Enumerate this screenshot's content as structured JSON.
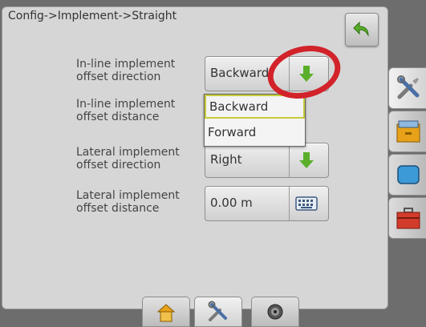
{
  "breadcrumb": "Config->Implement->Straight",
  "settings": [
    {
      "label": "In-line implement offset direction",
      "value": "Backward",
      "control": "arrow-down-icon"
    },
    {
      "label": "In-line implement offset distance",
      "value": "",
      "control": ""
    },
    {
      "label": "Lateral implement offset direction",
      "value": "Right",
      "control": "arrow-down-icon"
    },
    {
      "label": "Lateral implement offset distance",
      "value": "0.00 m",
      "control": "keyboard-icon"
    }
  ],
  "dropdown": {
    "options": [
      "Backward",
      "Forward"
    ],
    "selected": "Backward"
  },
  "icons": {
    "back": "back-arrow-icon",
    "side_tabs": [
      "tools-icon",
      "drawer-icon",
      "screen-icon",
      "toolbox-icon"
    ],
    "bottom_tabs": [
      "home-icon",
      "tools-icon",
      "camera-icon"
    ]
  },
  "colors": {
    "accent_green": "#5aae2a",
    "highlight_red": "#d2222a",
    "selection_border": "#c6cc38"
  }
}
